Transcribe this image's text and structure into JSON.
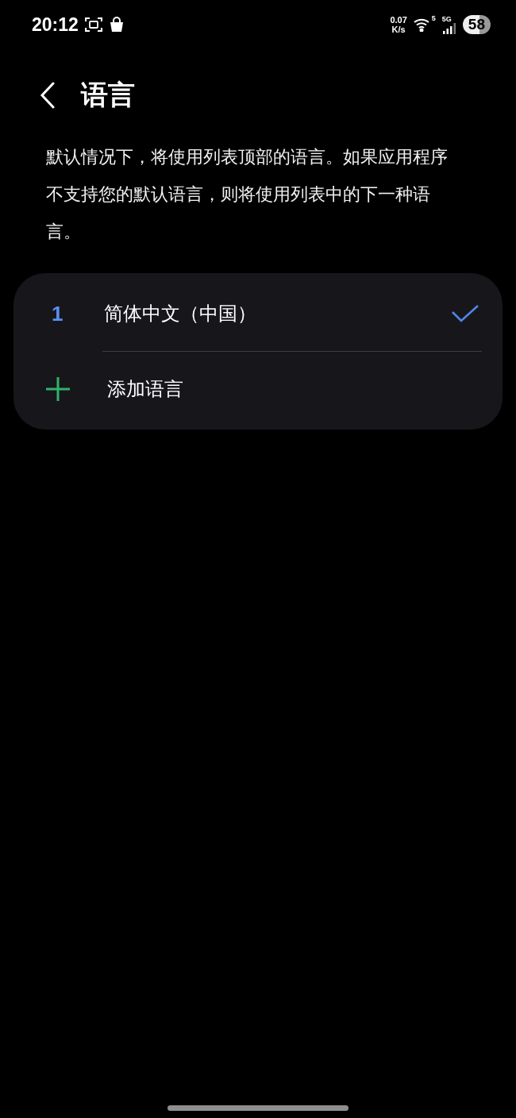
{
  "status_bar": {
    "time": "20:12",
    "net_speed": "0.07",
    "net_unit": "K/s",
    "wifi_badge": "5",
    "cell_badge": "5G",
    "battery": "58"
  },
  "header": {
    "title": "语言"
  },
  "description": "默认情况下，将使用列表顶部的语言。如果应用程序不支持您的默认语言，则将使用列表中的下一种语言。",
  "items": [
    {
      "kind": "language",
      "index": "1",
      "label": "简体中文（中国）",
      "selected": true
    },
    {
      "kind": "add",
      "label": "添加语言"
    }
  ]
}
